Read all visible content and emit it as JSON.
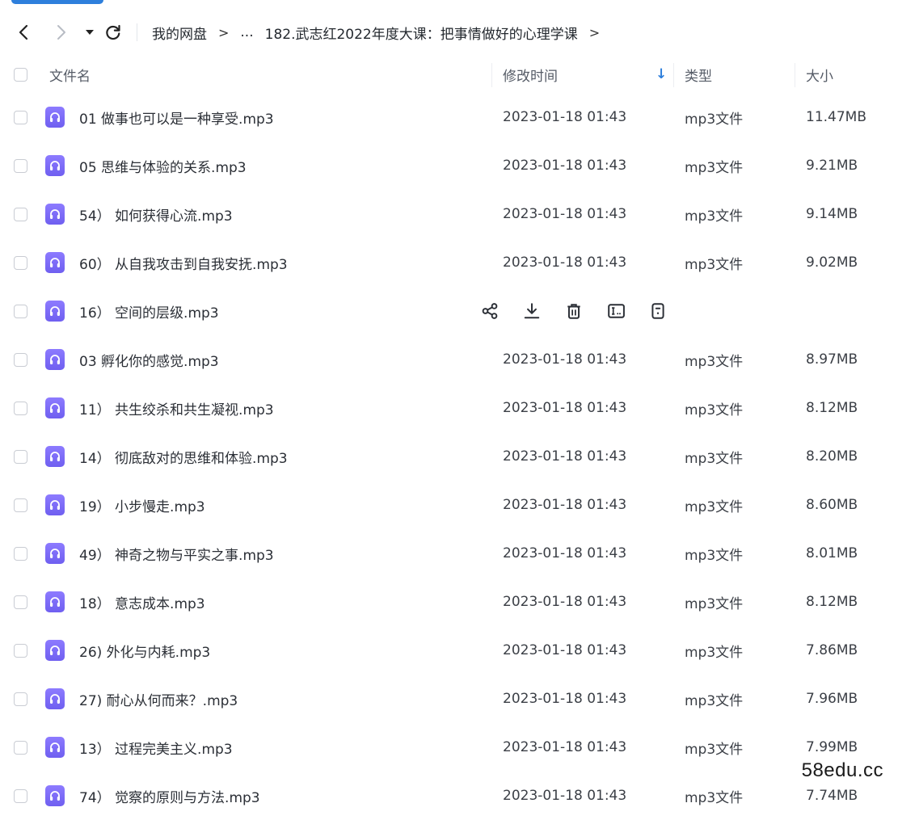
{
  "breadcrumb": {
    "root": "我的网盘",
    "sep1": ">",
    "ellipsis": "...",
    "sep2": "",
    "current": "182.武志红2022年度大课：把事情做好的心理学课",
    "sep3": ">"
  },
  "columns": {
    "name": "文件名",
    "mtime": "修改时间",
    "type": "类型",
    "size": "大小"
  },
  "sort_arrow": "↓",
  "rows": [
    {
      "name": "01 做事也可以是一种享受.mp3",
      "mtime": "2023-01-18 01:43",
      "type": "mp3文件",
      "size": "11.47MB"
    },
    {
      "name": "05 思维与体验的关系.mp3",
      "mtime": "2023-01-18 01:43",
      "type": "mp3文件",
      "size": "9.21MB"
    },
    {
      "name": "54）  如何获得心流.mp3",
      "mtime": "2023-01-18 01:43",
      "type": "mp3文件",
      "size": "9.14MB"
    },
    {
      "name": "60）  从自我攻击到自我安抚.mp3",
      "mtime": "2023-01-18 01:43",
      "type": "mp3文件",
      "size": "9.02MB"
    },
    {
      "name": "16）  空间的层级.mp3",
      "mtime": "",
      "type": "",
      "size": ""
    },
    {
      "name": "03 孵化你的感觉.mp3",
      "mtime": "2023-01-18 01:43",
      "type": "mp3文件",
      "size": "8.97MB"
    },
    {
      "name": "11）  共生绞杀和共生凝视.mp3",
      "mtime": "2023-01-18 01:43",
      "type": "mp3文件",
      "size": "8.12MB"
    },
    {
      "name": "14）  彻底敌对的思维和体验.mp3",
      "mtime": "2023-01-18 01:43",
      "type": "mp3文件",
      "size": "8.20MB"
    },
    {
      "name": "19）  小步慢走.mp3",
      "mtime": "2023-01-18 01:43",
      "type": "mp3文件",
      "size": "8.60MB"
    },
    {
      "name": "49）  神奇之物与平实之事.mp3",
      "mtime": "2023-01-18 01:43",
      "type": "mp3文件",
      "size": "8.01MB"
    },
    {
      "name": "18）  意志成本.mp3",
      "mtime": "2023-01-18 01:43",
      "type": "mp3文件",
      "size": "8.12MB"
    },
    {
      "name": "26) 外化与内耗.mp3",
      "mtime": "2023-01-18 01:43",
      "type": "mp3文件",
      "size": "7.86MB"
    },
    {
      "name": "27) 耐心从何而来？.mp3",
      "mtime": "2023-01-18 01:43",
      "type": "mp3文件",
      "size": "7.96MB"
    },
    {
      "name": "13）  过程完美主义.mp3",
      "mtime": "2023-01-18 01:43",
      "type": "mp3文件",
      "size": "7.99MB"
    },
    {
      "name": "74）  觉察的原则与方法.mp3",
      "mtime": "2023-01-18 01:43",
      "type": "mp3文件",
      "size": "7.74MB"
    }
  ],
  "watermark": "58edu.cc",
  "colors": {
    "accent": "#2e7fdc",
    "audio_icon": "#7565f5"
  },
  "icons": {
    "back": "chevron-left-icon",
    "forward": "chevron-right-icon",
    "history": "caret-down-icon",
    "refresh": "refresh-icon",
    "file": "audio-file-icon",
    "row_actions": [
      "share-icon",
      "download-icon",
      "delete-icon",
      "rename-icon",
      "more-icon"
    ]
  }
}
